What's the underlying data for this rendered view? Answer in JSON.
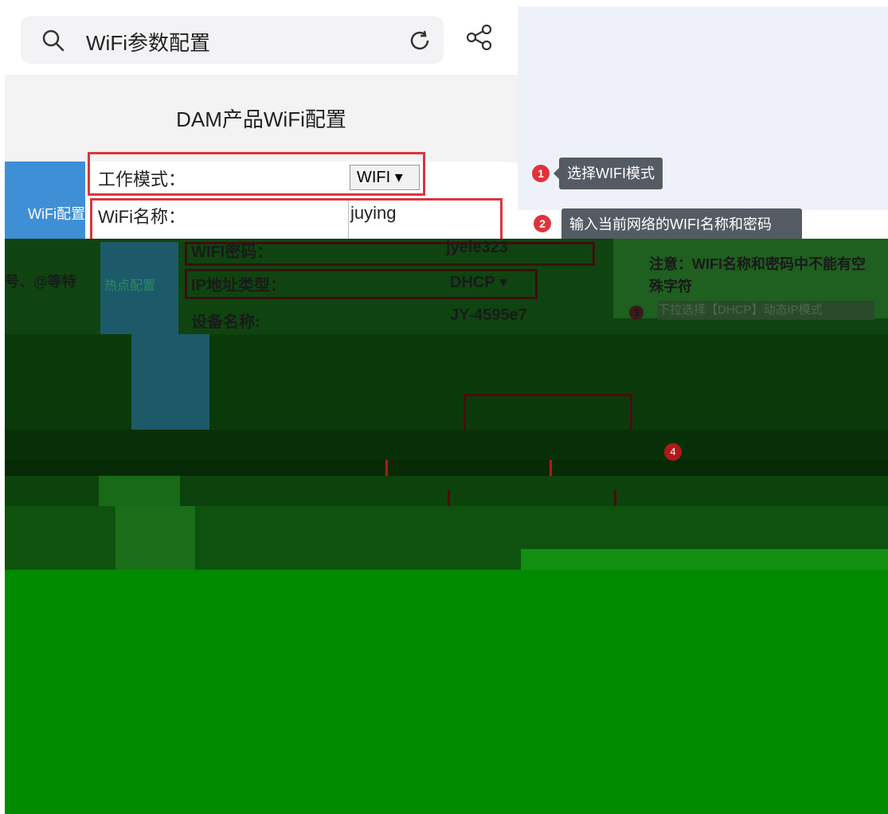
{
  "search": {
    "query": "WiFi参数配置"
  },
  "page": {
    "title": "DAM产品WiFi配置"
  },
  "left_tabs": {
    "wifi_config": "WiFi配置",
    "hotspot_config": "热点配置"
  },
  "form": {
    "work_mode_label": "工作模式：",
    "work_mode_value": "WIFI ▾",
    "wifi_name_label": "WiFi名称：",
    "wifi_name_value": "juying",
    "wifi_pwd_label": "WIFI密码：",
    "wifi_pwd_value": "jyele323",
    "ip_type_label": "IP地址类型：",
    "ip_type_value": "DHCP ▾",
    "device_name_label": "设备名称:",
    "device_name_value": "JY-4595e7"
  },
  "callouts": [
    {
      "num": "1",
      "text": "选择WIFI模式"
    },
    {
      "num": "2",
      "text": "输入当前网络的WIFI名称和密码"
    },
    {
      "num": "3",
      "text": "下拉选择【DHCP】动态IP模式"
    },
    {
      "num": "4",
      "text": ""
    }
  ],
  "notes": {
    "left_fragment": "号、@等特",
    "warning_line1": "注意：WIFI名称和密码中不能有空",
    "warning_line2": "殊字符"
  },
  "colors": {
    "accent_blue": "#3f8fd6",
    "highlight_red": "#d9363e",
    "glitch_green": "#008a00",
    "glitch_dark": "#0d3d0d"
  }
}
